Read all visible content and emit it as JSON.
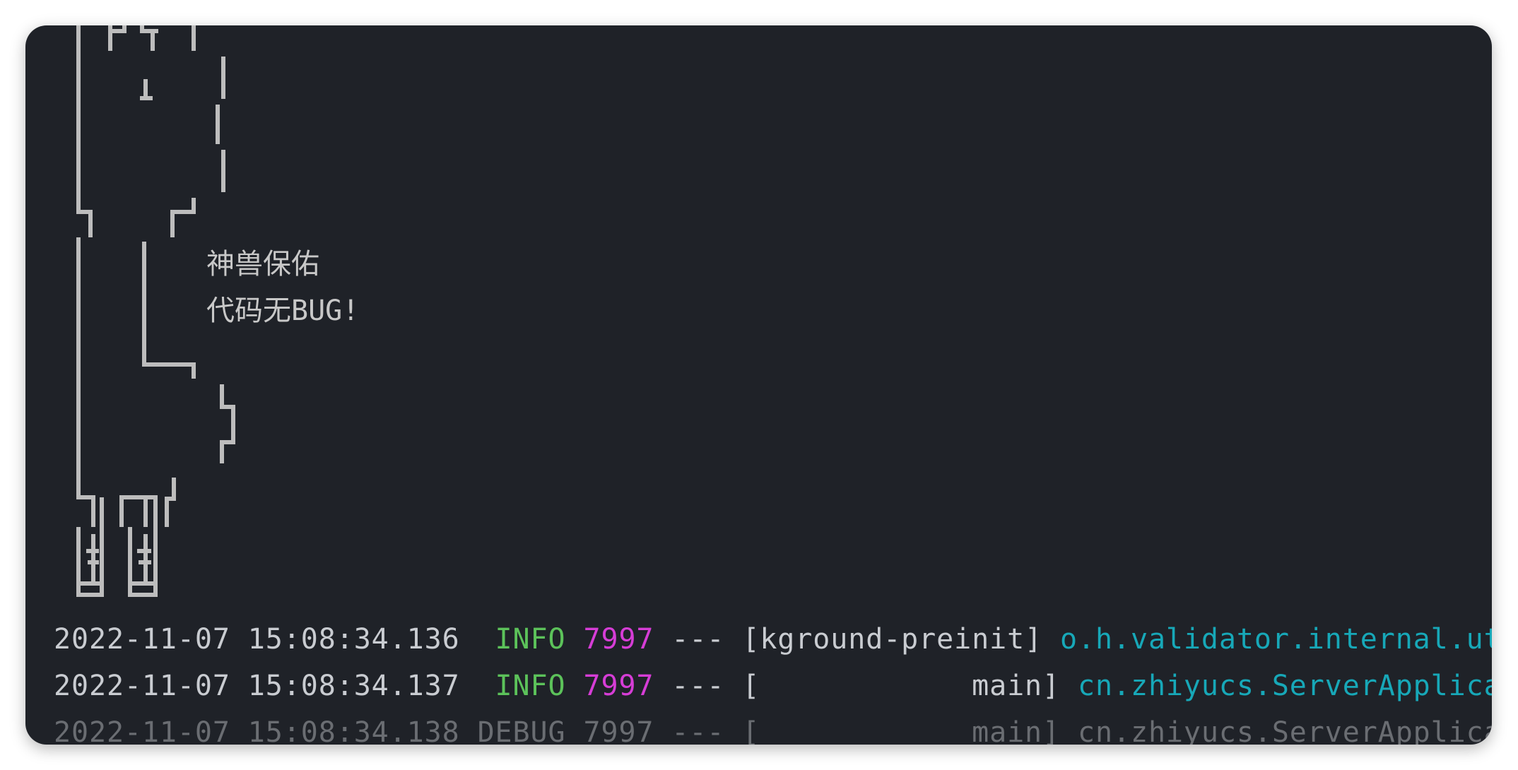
{
  "banner": {
    "line1": "神兽保佑",
    "line2": "代码无BUG!"
  },
  "log_lines": [
    {
      "timestamp": "2022-11-07 15:08:34.136",
      "level": " INFO",
      "pid": "7997",
      "sep": "---",
      "thread": "[kground-preinit]",
      "logger": "o.h.validator.internal.util."
    },
    {
      "timestamp": "2022-11-07 15:08:34.137",
      "level": " INFO",
      "pid": "7997",
      "sep": "---",
      "thread": "[            main]",
      "logger": "cn.zhiyucs.ServerApplication"
    },
    {
      "timestamp": "2022-11-07 15:08:34.138",
      "level": "DEBUG",
      "pid": "7997",
      "sep": "---",
      "thread": "[            main]",
      "logger": "cn.zhiyucs.ServerApplication"
    }
  ],
  "colors": {
    "background": "#1f2228",
    "info": "#5cc25a",
    "pid": "#d63dd6",
    "logger": "#17a8b8",
    "text": "#c9ccd1",
    "debug_dim": "#6a6d72"
  }
}
